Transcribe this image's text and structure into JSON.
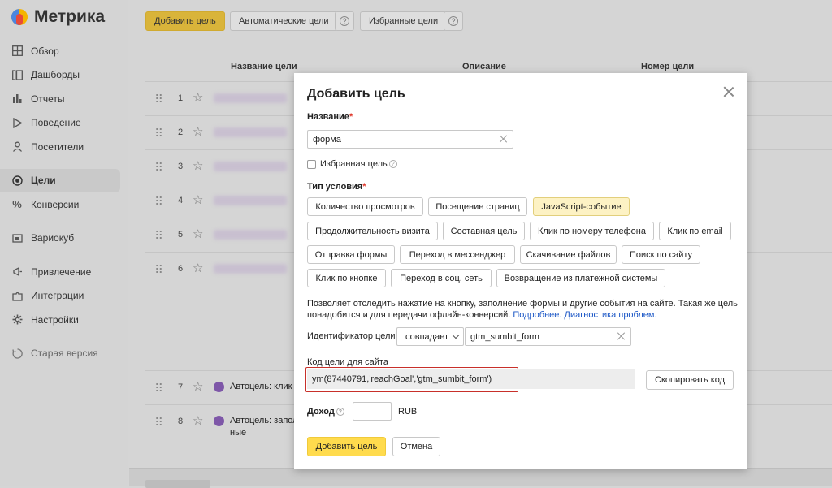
{
  "app": {
    "logo_text": "Метрика"
  },
  "sidebar": {
    "items": [
      {
        "label": "Обзор",
        "icon": "grid-icon"
      },
      {
        "label": "Дашборды",
        "icon": "dashboard-icon"
      },
      {
        "label": "Отчеты",
        "icon": "bar-chart-icon"
      },
      {
        "label": "Поведение",
        "icon": "play-icon"
      },
      {
        "label": "Посетители",
        "icon": "user-icon"
      },
      {
        "label": "Цели",
        "icon": "target-icon",
        "active": true
      },
      {
        "label": "Конверсии",
        "icon": "percent-icon"
      },
      {
        "label": "Вариокуб",
        "icon": "cube-icon"
      },
      {
        "label": "Привлечение",
        "icon": "megaphone-icon"
      },
      {
        "label": "Интеграции",
        "icon": "puzzle-icon"
      },
      {
        "label": "Настройки",
        "icon": "gear-icon"
      },
      {
        "label": "Старая версия",
        "icon": "history-icon"
      }
    ]
  },
  "toolbar": {
    "add_goal": "Добавить цель",
    "auto_goals": "Автоматические цели",
    "favorite_goals": "Избранные цели"
  },
  "table": {
    "columns": [
      "Название цели",
      "Описание",
      "Номер цели"
    ],
    "rows": [
      {
        "num": "1"
      },
      {
        "num": "2"
      },
      {
        "num": "3"
      },
      {
        "num": "4"
      },
      {
        "num": "5"
      },
      {
        "num": "6"
      },
      {
        "num": "7",
        "name": "Автоцель: клик п"
      },
      {
        "num": "8",
        "name": "Автоцель: запол",
        "name_line2": "ные"
      }
    ]
  },
  "modal": {
    "title": "Добавить цель",
    "name_label": "Название",
    "name_value": "форма",
    "favorite_label": "Избранная цель",
    "condition_label": "Тип условия",
    "conditions": [
      "Количество просмотров",
      "Посещение страниц",
      "JavaScript-событие",
      "Продолжительность визита",
      "Составная цель",
      "Клик по номеру телефона",
      "Клик по email",
      "Отправка формы",
      "Переход в мессенджер",
      "Скачивание файлов",
      "Поиск по сайту",
      "Клик по кнопке",
      "Переход в соц. сеть",
      "Возвращение из платежной системы"
    ],
    "selected_condition": "JavaScript-событие",
    "description_text": "Позволяет отследить нажатие на кнопку, заполнение формы и другие события на сайте. Такая же цель понадобится и для передачи офлайн-конверсий.",
    "link_more": "Подробнее.",
    "link_diag": "Диагностика проблем.",
    "identifier_label": "Идентификатор цели:",
    "match_select": "совпадает",
    "identifier_value": "gtm_sumbit_form",
    "code_label": "Код цели для сайта",
    "code_value": "ym(87440791,'reachGoal','gtm_sumbit_form')",
    "copy_button": "Скопировать код",
    "income_label": "Доход",
    "currency": "RUB",
    "submit_button": "Добавить цель",
    "cancel_button": "Отмена"
  },
  "colors": {
    "accent_yellow": "#ffdb4d",
    "selected_chip": "#fdf2c4",
    "highlight_red": "#c8302a",
    "link_blue": "#1a56c6"
  }
}
